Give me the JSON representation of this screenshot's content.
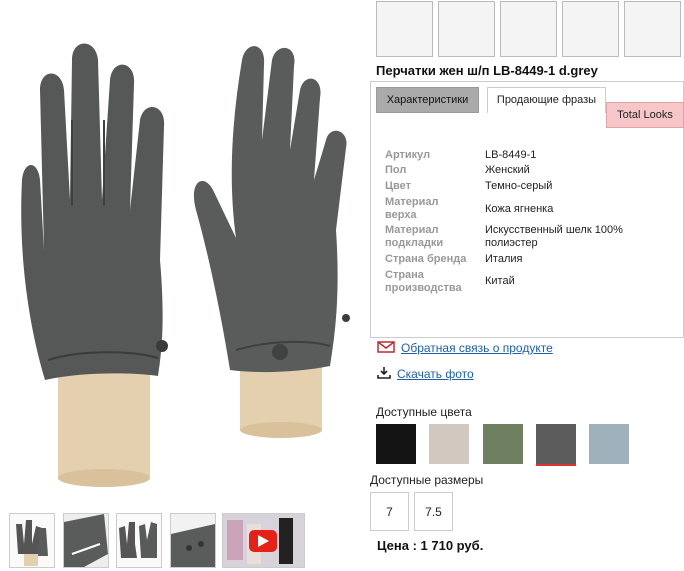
{
  "product": {
    "title": "Перчатки жен ш/п LB-8449-1 d.grey"
  },
  "tabs": [
    {
      "label": "Характеристики"
    },
    {
      "label": "Продающие фразы"
    },
    {
      "label": "Total Looks"
    }
  ],
  "specs": [
    {
      "label": "Артикул",
      "value": "LB-8449-1"
    },
    {
      "label": "Пол",
      "value": "Женский"
    },
    {
      "label": "Цвет",
      "value": "Темно-серый"
    },
    {
      "label": "Материал верха",
      "value": "Кожа ягненка"
    },
    {
      "label": "Материал подкладки",
      "value": "Искусственный шелк 100% полиэстер"
    },
    {
      "label": "Страна бренда",
      "value": "Италия"
    },
    {
      "label": "Страна производства",
      "value": "Китай"
    }
  ],
  "links": {
    "feedback": "Обратная связь о продукте",
    "download": "Скачать фото"
  },
  "colors": {
    "label": "Доступные цвета",
    "swatches": [
      {
        "name": "black",
        "hex": "#141414"
      },
      {
        "name": "beige",
        "hex": "#d2c8c0"
      },
      {
        "name": "green",
        "hex": "#6e8060"
      },
      {
        "name": "dark-grey",
        "hex": "#5c5c5c",
        "selected": true
      },
      {
        "name": "light-blue",
        "hex": "#9fb1ba"
      }
    ]
  },
  "sizes": {
    "label": "Доступные размеры",
    "options": [
      "7",
      "7.5"
    ]
  },
  "price": "Цена : 1 710 руб.",
  "accent": "#1a5fb4"
}
